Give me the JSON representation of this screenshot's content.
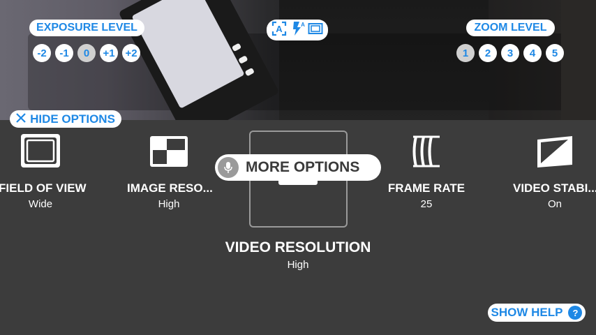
{
  "exposure": {
    "label": "EXPOSURE LEVEL",
    "levels": [
      "-2",
      "-1",
      "0",
      "+1",
      "+2"
    ],
    "selected": "0"
  },
  "zoom": {
    "label": "ZOOM LEVEL",
    "levels": [
      "1",
      "2",
      "3",
      "4",
      "5"
    ],
    "selected": "1"
  },
  "mode_icons": [
    "auto-focus-icon",
    "flash-auto-icon",
    "aspect-ratio-icon"
  ],
  "hide_options": {
    "icon": "close-icon",
    "label": "HIDE OPTIONS"
  },
  "options": [
    {
      "title": "FIELD OF VIEW",
      "value": "Wide",
      "icon": "field-of-view-icon"
    },
    {
      "title": "IMAGE RESO...",
      "value": "High",
      "icon": "image-resolution-icon"
    },
    {
      "title": "VIDEO RESOLUTION",
      "value": "High",
      "icon": "video-resolution-icon"
    },
    {
      "title": "FRAME RATE",
      "value": "25",
      "icon": "frame-rate-icon"
    },
    {
      "title": "VIDEO STABI...",
      "value": "On",
      "icon": "video-stabilization-icon"
    }
  ],
  "more_options": {
    "icon": "microphone-icon",
    "label": "MORE OPTIONS"
  },
  "show_help": {
    "label": "SHOW HELP",
    "icon": "help-icon",
    "glyph": "?"
  },
  "colors": {
    "accent": "#1e88e5",
    "panel": "#3c3c3c",
    "pill": "#ffffff"
  }
}
